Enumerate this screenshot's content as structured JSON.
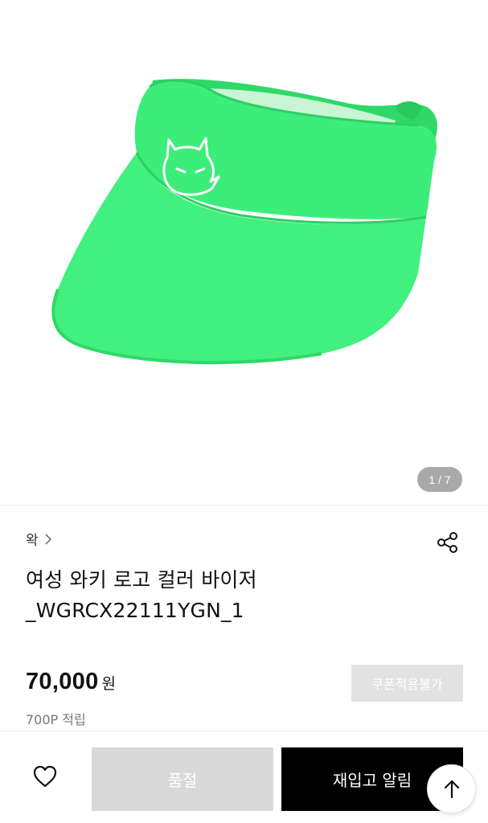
{
  "gallery": {
    "pager_text": "1 / 7",
    "product_color": "#3ded7a"
  },
  "brand": {
    "name": "왁",
    "chevron_icon": "chevron-right-icon"
  },
  "share": {
    "icon": "share-icon"
  },
  "product": {
    "title_line1": "여성 와키 로고 컬러 바이저",
    "title_line2": "_WGRCX22111YGN_1",
    "price": "70,000",
    "currency": "원",
    "points": "700P 적립"
  },
  "coupon": {
    "label": "쿠폰적용불가"
  },
  "actions": {
    "wish_icon": "heart-icon",
    "soldout_label": "품절",
    "restock_label": "재입고 알림",
    "scroll_top_icon": "arrow-up-icon"
  }
}
